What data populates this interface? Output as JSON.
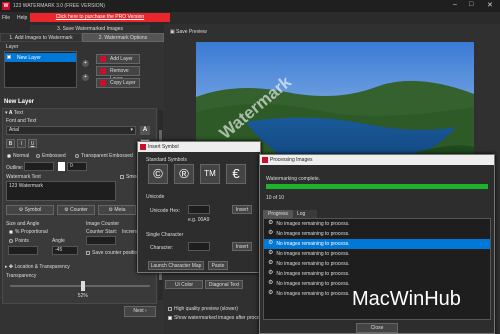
{
  "window": {
    "title": "123 WATERMARK 3.0 (FREE VERSION)"
  },
  "menu": {
    "file": "File",
    "help": "Help"
  },
  "promo": "Click here to purchase the PRO Version",
  "steps": {
    "save_tab": "3. Save Watermarked Images",
    "add_tab": "1. Add Images to Watermark",
    "options_tab": "2. Watermark Options",
    "save_preview": "Save Preview"
  },
  "layers": {
    "heading": "Layer",
    "items": [
      "New Layer"
    ],
    "add": "Add Layer",
    "remove": "Remove Layer",
    "copy": "Copy Layer"
  },
  "new_layer": {
    "heading": "New Layer",
    "text_section": "Text",
    "font_and_text": "Font and Text",
    "font": "Arial",
    "styles": [
      "B",
      "I",
      "U"
    ],
    "mode_normal": "Normal",
    "mode_embossed": "Embossed",
    "mode_transparent": "Transparent Embossed",
    "outline_label": "Outline:",
    "outline_value": "0",
    "watermark_text_label": "Watermark Text",
    "watermark_text": "123 Watermark",
    "smooth_label": "Smooth",
    "tools": {
      "symbol": "Symbol",
      "counter": "Counter",
      "meta": "Meta"
    },
    "size_angle": "Size and Angle",
    "pct_proportional": "% Proportional",
    "points": "Points",
    "angle_label": "Angle",
    "angle_value": "-45",
    "image_counter": "Image Counter",
    "counter_start": "Counter Start:",
    "increment": "Increment",
    "save_counter": "Save counter position",
    "location_section": "Location & Transparency",
    "transparency_label": "Transparency",
    "transparency_value": "52%",
    "transparency_fraction": 0.52
  },
  "next_button": "Next",
  "preview": {
    "watermark": "Watermark",
    "ui_button_left": "Ui Color",
    "ui_button_right": "Diagonal Text"
  },
  "options": {
    "hq_preview": "High quality preview (slower)",
    "show_after": "Show watermarked images after proce"
  },
  "insert_symbol": {
    "title": "Insert Symbol",
    "standard": "Standard Symbols",
    "symbols": [
      "©",
      "®",
      "TM",
      "€"
    ],
    "unicode": "Unicode",
    "unicode_hex": "Unicode Hex:",
    "eg": "e.g. 00A9",
    "insert": "Insert",
    "single": "Single Character",
    "character": "Character:",
    "launch": "Launch Character Map",
    "paste": "Paste"
  },
  "processing": {
    "title": "Processing Images",
    "complete": "Watermarking complete.",
    "progress_fraction": 1.0,
    "count": "10 of 10",
    "tabs": [
      "Progress",
      "Log"
    ],
    "rows": [
      "No images remaining to process.",
      "No images remaining to process.",
      "No images remaining to process.",
      "No images remaining to process.",
      "No images remaining to process.",
      "No images remaining to process.",
      "No images remaining to process.",
      "No images remaining to process."
    ],
    "selected_row": 2,
    "close": "Close"
  },
  "brand": "MacWinHub",
  "colors": {
    "promo": "#e8262b",
    "selected": "#0078d7",
    "progress": "#1db32a",
    "icon": "#c8102e"
  }
}
